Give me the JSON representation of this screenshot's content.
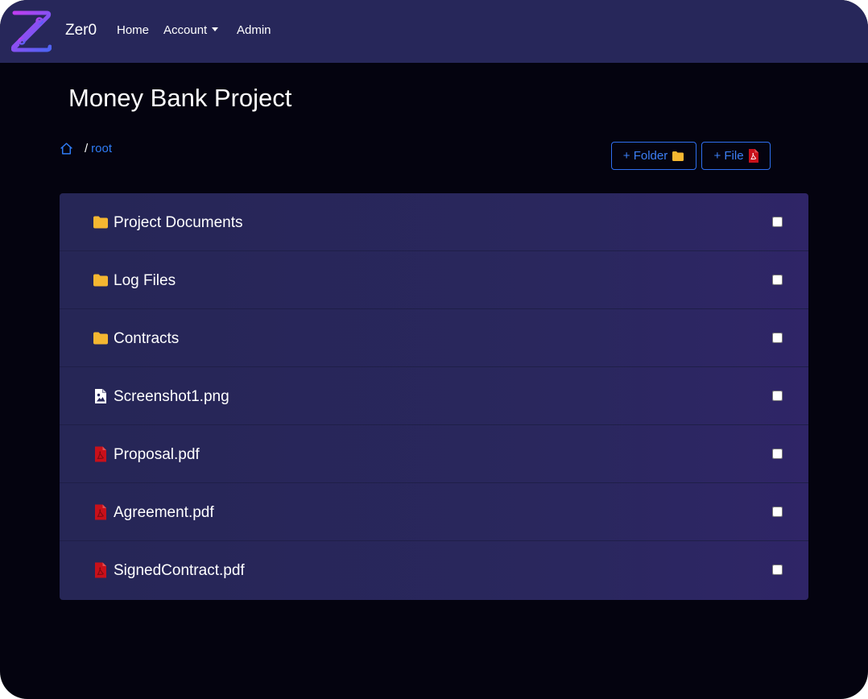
{
  "navbar": {
    "brand": "Zer0",
    "logo_icon": "z-logo-icon",
    "links": {
      "home": "Home",
      "account": "Account",
      "admin": "Admin"
    }
  },
  "page": {
    "title": "Money Bank Project"
  },
  "breadcrumb": {
    "home_icon": "house-icon",
    "separator": "/",
    "current": "root"
  },
  "actions": {
    "add_folder_label": "+ Folder",
    "add_file_label": "+ File"
  },
  "files": [
    {
      "name": "Project Documents",
      "type": "folder",
      "icon": "folder-icon",
      "checked": false
    },
    {
      "name": "Log Files",
      "type": "folder",
      "icon": "folder-icon",
      "checked": false
    },
    {
      "name": "Contracts",
      "type": "folder",
      "icon": "folder-icon",
      "checked": false
    },
    {
      "name": "Screenshot1.png",
      "type": "image",
      "icon": "image-file-icon",
      "checked": false
    },
    {
      "name": "Proposal.pdf",
      "type": "pdf",
      "icon": "pdf-file-icon",
      "checked": false
    },
    {
      "name": "Agreement.pdf",
      "type": "pdf",
      "icon": "pdf-file-icon",
      "checked": false
    },
    {
      "name": "SignedContract.pdf",
      "type": "pdf",
      "icon": "pdf-file-icon",
      "checked": false
    }
  ],
  "colors": {
    "background": "#04030f",
    "navbar": "#27275a",
    "accent_blue": "#2f7bf5",
    "folder_yellow": "#f5b731",
    "pdf_red": "#c8101a"
  }
}
